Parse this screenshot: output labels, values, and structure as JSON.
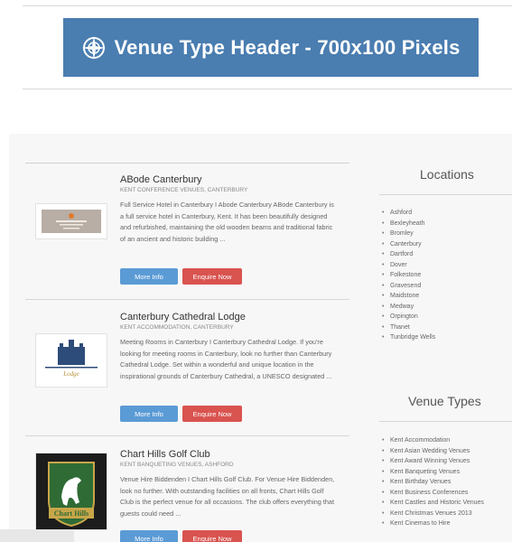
{
  "banner": {
    "text": "Venue Type Header - 700x100 Pixels"
  },
  "listings": [
    {
      "title": "ABode Canterbury",
      "subtitle": "KENT CONFERENCE VENUES, CANTERBURY",
      "description": "Full Service Hotel in Canterbury I Abode Canterbury  ABode Canterbury is a full service hotel in Canterbury, Kent. It has been beautifully designed and refurbished, maintaining the old wooden beams and traditional fabric of an ancient and historic building ...",
      "more_info": "More Info",
      "enquire": "Enquire Now"
    },
    {
      "title": "Canterbury Cathedral Lodge",
      "subtitle": "KENT ACCOMMODATION, CANTERBURY",
      "description": "Meeting Rooms in Canterbury I Canterbury Cathedral Lodge. If you're looking for meeting rooms in Canterbury, look no further than Canterbury Cathedral Lodge. Set within a wonderful and unique location in the inspirational grounds of Canterbury Cathedral, a UNESCO designated ...",
      "more_info": "More Info",
      "enquire": "Enquire Now"
    },
    {
      "title": "Chart Hills Golf Club",
      "subtitle": "KENT BANQUETING VENUES, ASHFORD",
      "description": "Venue Hire Biddenden I Chart Hills Golf Club.  For Venue Hire Biddenden, look no further. With outstanding facilities on all fronts, Chart Hills Golf Club is the perfect venue for all occasions. The club offers everything that guests could need ...",
      "more_info": "More Info",
      "enquire": "Enquire Now",
      "logo_text": "Chart Hills"
    }
  ],
  "sidebar": {
    "locations_title": "Locations",
    "locations": [
      "Ashford",
      "Bexleyheath",
      "Bromley",
      "Canterbury",
      "Dartford",
      "Dover",
      "Folkestone",
      "Gravesend",
      "Maidstone",
      "Medway",
      "Orpington",
      "Thanet",
      "Tunbridge Wells"
    ],
    "venue_types_title": "Venue Types",
    "venue_types": [
      "Kent Accommodation",
      "Kent Asian Wedding Venues",
      "Kent Award Winning Venues",
      "Kent Banqueting Venues",
      "Kent Birthday Venues",
      "Kent Business Conferences",
      "Kent Castles and Historic Venues",
      "Kent Christmas Venues 2013",
      "Kent Cinemas to Hire"
    ]
  },
  "colors": {
    "banner": "#4a7db0",
    "more_info": "#5b9bd5",
    "enquire": "#d9534f"
  },
  "icons": {
    "banner": "compass-icon"
  }
}
